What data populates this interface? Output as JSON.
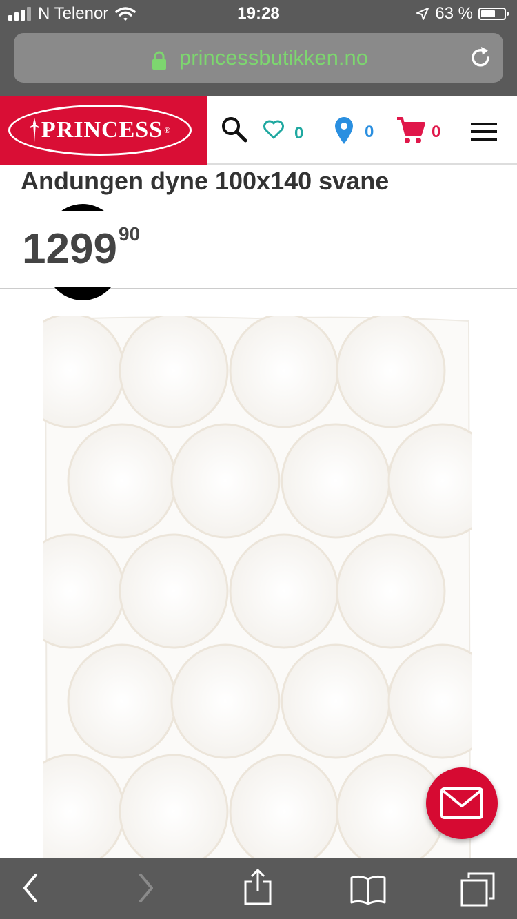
{
  "status_bar": {
    "carrier": "N Telenor",
    "time": "19:28",
    "battery_percent": "63 %",
    "battery_level": 0.63
  },
  "browser": {
    "url": "princessbutikken.no"
  },
  "header": {
    "logo_text": "PRINCESS",
    "wishlist_count": "0",
    "stores_count": "0",
    "cart_count": "0"
  },
  "product": {
    "title": "Andungen dyne 100x140 svane",
    "price_main": "1299",
    "price_cents": "90"
  },
  "colors": {
    "brand_red": "#d90e35",
    "wishlist_teal": "#1fa8a0",
    "location_blue": "#2a8fe0",
    "cart_red": "#e0174a",
    "url_green": "#7dd66f",
    "chrome_gray": "#5a5a5a"
  },
  "icons": {
    "search": "search-icon",
    "wishlist": "heart-icon",
    "stores": "location-pin-icon",
    "cart": "cart-icon",
    "menu": "hamburger-menu-icon",
    "contact": "envelope-icon"
  }
}
